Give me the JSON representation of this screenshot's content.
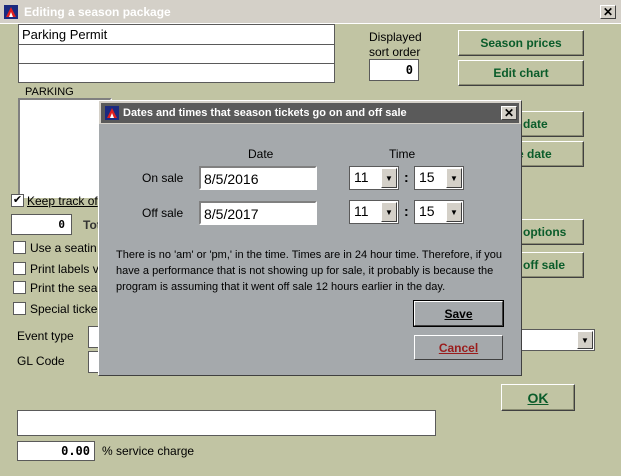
{
  "window": {
    "title": "Editing a season package"
  },
  "package": {
    "name": "Parking Permit",
    "line2": "",
    "line3": "",
    "description_label": "PARKING",
    "sort_order_label_1": "Displayed",
    "sort_order_label_2": "sort order",
    "sort_order": "0"
  },
  "buttons": {
    "season_prices": "Season prices",
    "edit_chart": "Edit chart",
    "date_1": "date",
    "date_2": "e date",
    "options": "options",
    "off_sale": "off sale",
    "ok": "OK"
  },
  "checks": {
    "keep_track": "Keep track of",
    "total_label": "Tot",
    "total_value": "0",
    "use_seating": "Use a seatin",
    "print_labels": "Print labels v",
    "print_season": "Print the sea",
    "special_tickets": "Special ticke"
  },
  "fields": {
    "event_type_label": "Event type",
    "gl_code_label": "GL Code",
    "service_charge_value": "0.00",
    "service_charge_label": "% service charge"
  },
  "dialog": {
    "title": "Dates and times that season tickets go on and off sale",
    "date_header": "Date",
    "time_header": "Time",
    "on_sale_label": "On sale",
    "on_sale_date": "8/5/2016",
    "on_sale_hour": "11",
    "on_sale_minute": "15",
    "off_sale_label": "Off sale",
    "off_sale_date": "8/5/2017",
    "off_sale_hour": "11",
    "off_sale_minute": "15",
    "colon": ":",
    "note": "There is no 'am' or 'pm,' in the time. Times are in 24 hour time. Therefore, if you have a performance that is not showing up for sale, it probably is because the program is assuming that it went off sale 12 hours earlier in the day.",
    "save": "Save",
    "cancel": "Cancel"
  },
  "icons": {
    "app": "app-logo-icon",
    "close": "close-icon",
    "dropdown": "chevron-down-icon"
  },
  "colors": {
    "main_bg": "#c1c4a3",
    "dialog_bg": "#a5a9ac",
    "button_text": "#0a5c2a",
    "cancel_text": "#9a1c1c"
  }
}
